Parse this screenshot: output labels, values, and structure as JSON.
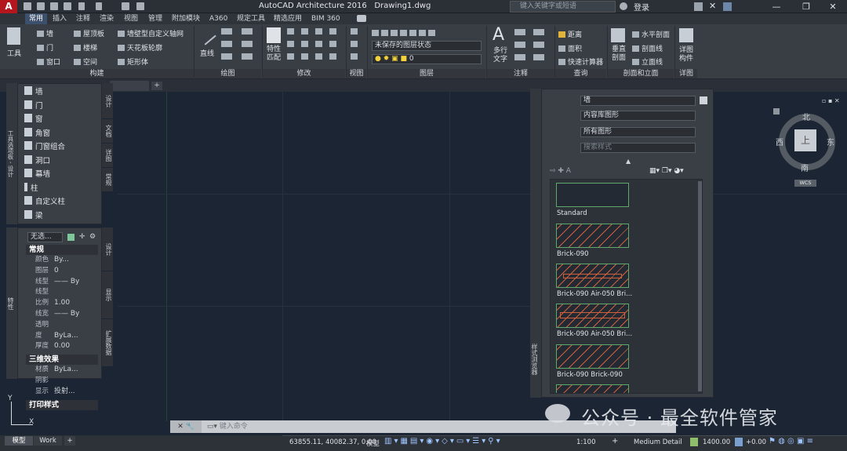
{
  "app": {
    "title": "AutoCAD Architecture 2016",
    "document": "Drawing1.dwg",
    "logo": "A",
    "search_placeholder": "键入关键字或短语",
    "login": "登录"
  },
  "ribbon_tabs": [
    "常用",
    "插入",
    "注释",
    "渲染",
    "视图",
    "管理",
    "附加模块",
    "A360",
    "规定工具",
    "精选应用",
    "BIM 360"
  ],
  "ribbon": {
    "tool_btn": "工具",
    "build": {
      "items": [
        "墙",
        "门",
        "窗口",
        "屋顶板",
        "楼梯",
        "空间",
        "墙壁型自定义轴网",
        "天花板轮廓",
        "矩形体"
      ],
      "title": "构建"
    },
    "draw": {
      "line": "直线",
      "title": "绘图"
    },
    "modify": {
      "title": "修改",
      "match": "特性\n匹配"
    },
    "view": {
      "title": "视图"
    },
    "layers": {
      "state": "未保存的图层状态",
      "layer": "0",
      "title": "图层"
    },
    "annotation": {
      "mtext": "多行\n文字",
      "title": "注释"
    },
    "inquiry": {
      "items": [
        "距离",
        "面积",
        "快速计算器"
      ],
      "title": "查询"
    },
    "section": {
      "items": [
        "水平剖面",
        "剖面线",
        "立面线"
      ],
      "vertical": "垂直\n剖面",
      "title": "剖面和立面"
    },
    "detail": {
      "btn": "详图\n构件",
      "title": "详图"
    }
  },
  "tool_palette": {
    "items": [
      "墙",
      "门",
      "窗",
      "角窗",
      "门窗组合",
      "洞口",
      "幕墙",
      "柱",
      "自定义柱",
      "梁"
    ],
    "side_tabs": [
      "设计",
      "文档",
      "详图",
      "常规"
    ],
    "vertical_title": "工具选项板 - 设计"
  },
  "properties": {
    "selector": "无选...",
    "sections": [
      {
        "name": "常规",
        "rows": [
          [
            "颜色",
            "By..."
          ],
          [
            "图层",
            "0"
          ],
          [
            "线型",
            "—— By"
          ],
          [
            "线型比例",
            "1.00"
          ],
          [
            "线宽",
            "—— By"
          ],
          [
            "透明度",
            "ByLa..."
          ],
          [
            "厚度",
            "0.00"
          ]
        ]
      },
      {
        "name": "三维效果",
        "rows": [
          [
            "材质",
            "ByLa..."
          ],
          [
            "阴影显示",
            "投射..."
          ]
        ]
      },
      {
        "name": "打印样式",
        "rows": []
      }
    ],
    "side_tabs": [
      "设计",
      "显示",
      "扩展数据"
    ],
    "vertical_title": "特性"
  },
  "style_browser": {
    "dd1": "墙",
    "dd2": "内容库图形",
    "dd3": "所有图形",
    "search_placeholder": "搜索样式",
    "styles": [
      "Standard",
      "Brick-090",
      "Brick-090 Air-050 Bri...",
      "Brick-090 Air-050 Bri...",
      "Brick-090 Brick-090"
    ],
    "vertical_title": "样式浏览器"
  },
  "viewcube": {
    "n": "北",
    "s": "南",
    "e": "东",
    "w": "西",
    "top": "上",
    "wcs": "WCS"
  },
  "ucs": {
    "y": "Y",
    "x": "X"
  },
  "command_placeholder": "键入命令",
  "layout_tabs": [
    "模型",
    "Work"
  ],
  "status": {
    "coords": "63855.11, 40082.37, 0.00",
    "model": "模型",
    "scale": "1:100",
    "detail": "Medium Detail",
    "elev": "1400.00",
    "offset": "+0.00"
  },
  "watermark": "公众号 · 最全软件管家"
}
